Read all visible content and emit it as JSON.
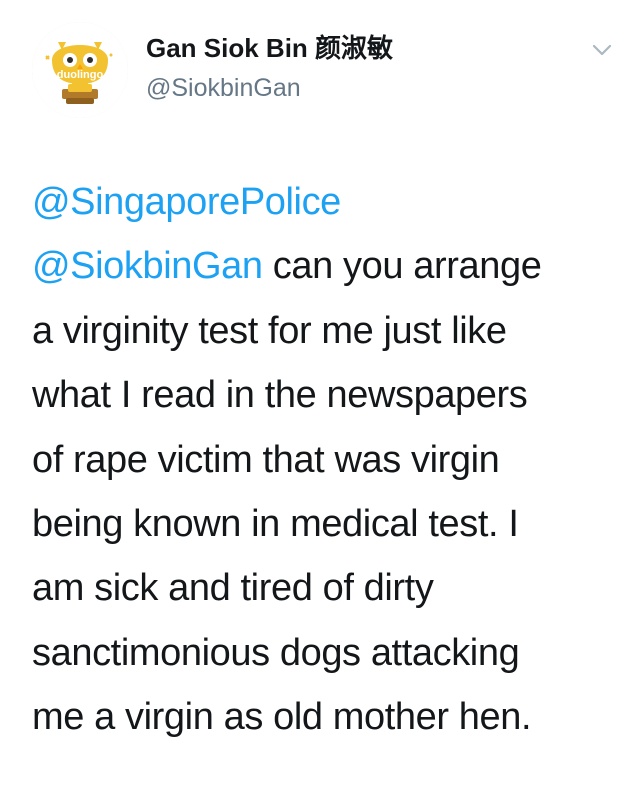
{
  "tweet": {
    "author": {
      "display_name": "Gan Siok Bin 颜淑敏",
      "handle": "@SiokbinGan",
      "avatar_text": "duolingo",
      "avatar_icon": "duolingo-owl-icon"
    },
    "menu_icon": "chevron-down-icon",
    "mentions": [
      "@SingaporePolice",
      "@SiokbinGan"
    ],
    "lines": [
      "a virginity test for me just like",
      "what I read in the newspapers",
      "of rape victim that was virgin",
      "being known in medical test. I",
      "am sick and tired of dirty",
      "sanctimonious dogs attacking",
      "me a virgin as old mother hen."
    ],
    "line1_tail": " can you arrange"
  },
  "colors": {
    "mention": "#1da1f2",
    "text": "#14171a",
    "secondary": "#657786",
    "owl": "#f2c230",
    "owl_base": "#b07a2a"
  }
}
